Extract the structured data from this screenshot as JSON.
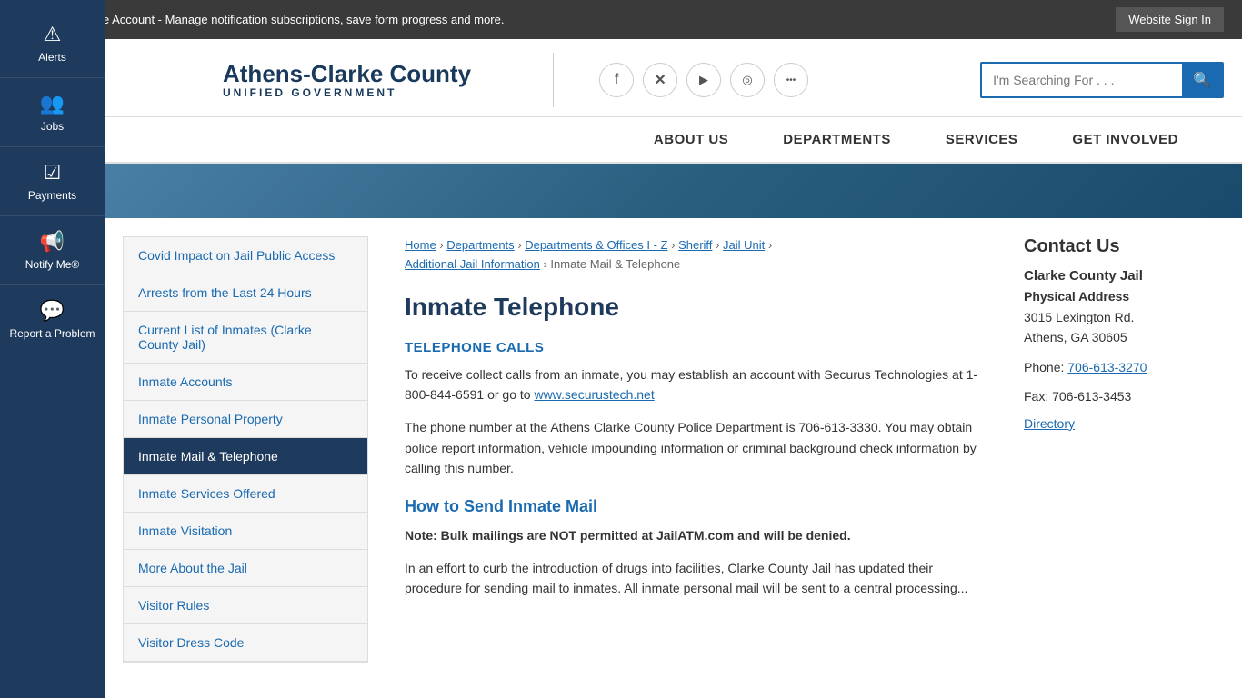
{
  "topBanner": {
    "message": "Create a Website Account - Manage notification subscriptions, save form progress and more.",
    "signInLabel": "Website Sign In"
  },
  "header": {
    "logoTitle": "Athens-Clarke County",
    "logoSubtitle": "UNIFIED GOVERNMENT",
    "searchPlaceholder": "I'm Searching For . . .",
    "socialIcons": [
      {
        "name": "facebook-icon",
        "symbol": "f"
      },
      {
        "name": "twitter-x-icon",
        "symbol": "✕"
      },
      {
        "name": "youtube-icon",
        "symbol": "▶"
      },
      {
        "name": "instagram-icon",
        "symbol": "◎"
      },
      {
        "name": "more-icon",
        "symbol": "•••"
      }
    ]
  },
  "mainNav": {
    "items": [
      {
        "label": "ABOUT US",
        "href": "#"
      },
      {
        "label": "DEPARTMENTS",
        "href": "#"
      },
      {
        "label": "SERVICES",
        "href": "#"
      },
      {
        "label": "GET INVOLVED",
        "href": "#"
      }
    ]
  },
  "leftSidebar": {
    "items": [
      {
        "label": "Alerts",
        "icon": "⚠",
        "name": "alerts"
      },
      {
        "label": "Jobs",
        "icon": "👥",
        "name": "jobs"
      },
      {
        "label": "Payments",
        "icon": "☑",
        "name": "payments"
      },
      {
        "label": "Notify Me®",
        "icon": "📢",
        "name": "notify"
      },
      {
        "label": "Report a Problem",
        "icon": "💬",
        "name": "report"
      }
    ]
  },
  "sideNav": {
    "items": [
      {
        "label": "Covid Impact on Jail Public Access",
        "href": "#",
        "active": false
      },
      {
        "label": "Arrests from the Last 24 Hours",
        "href": "#",
        "active": false
      },
      {
        "label": "Current List of Inmates (Clarke County Jail)",
        "href": "#",
        "active": false
      },
      {
        "label": "Inmate Accounts",
        "href": "#",
        "active": false
      },
      {
        "label": "Inmate Personal Property",
        "href": "#",
        "active": false
      },
      {
        "label": "Inmate Mail & Telephone",
        "href": "#",
        "active": true
      },
      {
        "label": "Inmate Services Offered",
        "href": "#",
        "active": false
      },
      {
        "label": "Inmate Visitation",
        "href": "#",
        "active": false
      },
      {
        "label": "More About the Jail",
        "href": "#",
        "active": false
      },
      {
        "label": "Visitor Rules",
        "href": "#",
        "active": false
      },
      {
        "label": "Visitor Dress Code",
        "href": "#",
        "active": false
      }
    ]
  },
  "breadcrumb": {
    "parts": [
      {
        "label": "Home",
        "href": "#"
      },
      {
        "label": "Departments",
        "href": "#"
      },
      {
        "label": "Departments & Offices I - Z",
        "href": "#"
      },
      {
        "label": "Sheriff",
        "href": "#"
      },
      {
        "label": "Jail Unit",
        "href": "#"
      },
      {
        "label": "Additional Jail Information",
        "href": "#"
      },
      {
        "label": "Inmate Mail & Telephone",
        "href": null
      }
    ]
  },
  "mainContent": {
    "pageTitle": "Inmate Telephone",
    "section1Title": "TELEPHONE CALLS",
    "section1Text1": "To receive collect calls from an inmate, you may establish an account with Securus Technologies at 1-800-844-6591 or go to",
    "section1Link": "www.securustech.net",
    "section1Text2": "The phone number at the Athens Clarke County Police Department is 706-613-3330. You may obtain police report information, vehicle impounding information or criminal background check information by calling this number.",
    "section2Title": "How to Send Inmate Mail",
    "section2Bold": "Note: Bulk mailings are NOT permitted at JailATM.com and will be denied.",
    "section2Text": "In an effort to curb the introduction of drugs into facilities, Clarke County Jail has updated their procedure for sending mail to inmates. All inmate personal mail will be sent to a central processing..."
  },
  "contactSidebar": {
    "title": "Contact Us",
    "facilityName": "Clarke County Jail",
    "addressLabel": "Physical Address",
    "address1": "3015 Lexington Rd.",
    "address2": "Athens, GA 30605",
    "phoneLabel": "Phone:",
    "phone": "706-613-3270",
    "faxLabel": "Fax:",
    "fax": "706-613-3453",
    "directoryLabel": "Directory"
  }
}
